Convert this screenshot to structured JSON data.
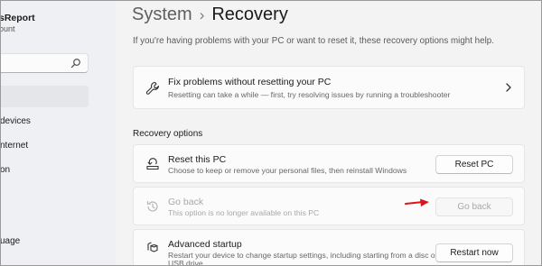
{
  "sidebar": {
    "account_name": "sReport",
    "account_sub": "ount",
    "search": {
      "value": "",
      "placeholder": ""
    },
    "items": [
      {
        "label": "devices"
      },
      {
        "label": "nternet"
      },
      {
        "label": "on"
      },
      {
        "label": "uage"
      }
    ]
  },
  "header": {
    "breadcrumb_parent": "System",
    "separator": "›",
    "page_title": "Recovery"
  },
  "intro_text": "If you're having problems with your PC or want to reset it, these recovery options might help.",
  "fix_card": {
    "title": "Fix problems without resetting your PC",
    "description": "Resetting can take a while — first, try resolving issues by running a troubleshooter"
  },
  "section_title": "Recovery options",
  "options": [
    {
      "title": "Reset this PC",
      "description": "Choose to keep or remove your personal files, then reinstall Windows",
      "button": "Reset PC",
      "enabled": true
    },
    {
      "title": "Go back",
      "description": "This option is no longer available on this PC",
      "button": "Go back",
      "enabled": false
    },
    {
      "title": "Advanced startup",
      "description": "Restart your device to change startup settings, including starting from a disc or",
      "description2": "USB drive",
      "button": "Restart now",
      "enabled": true
    }
  ],
  "colors": {
    "annotation_arrow": "#d9161c",
    "background": "#f3f3f3",
    "card": "#fbfbfb",
    "disabled_text": "#a8a8a8"
  }
}
